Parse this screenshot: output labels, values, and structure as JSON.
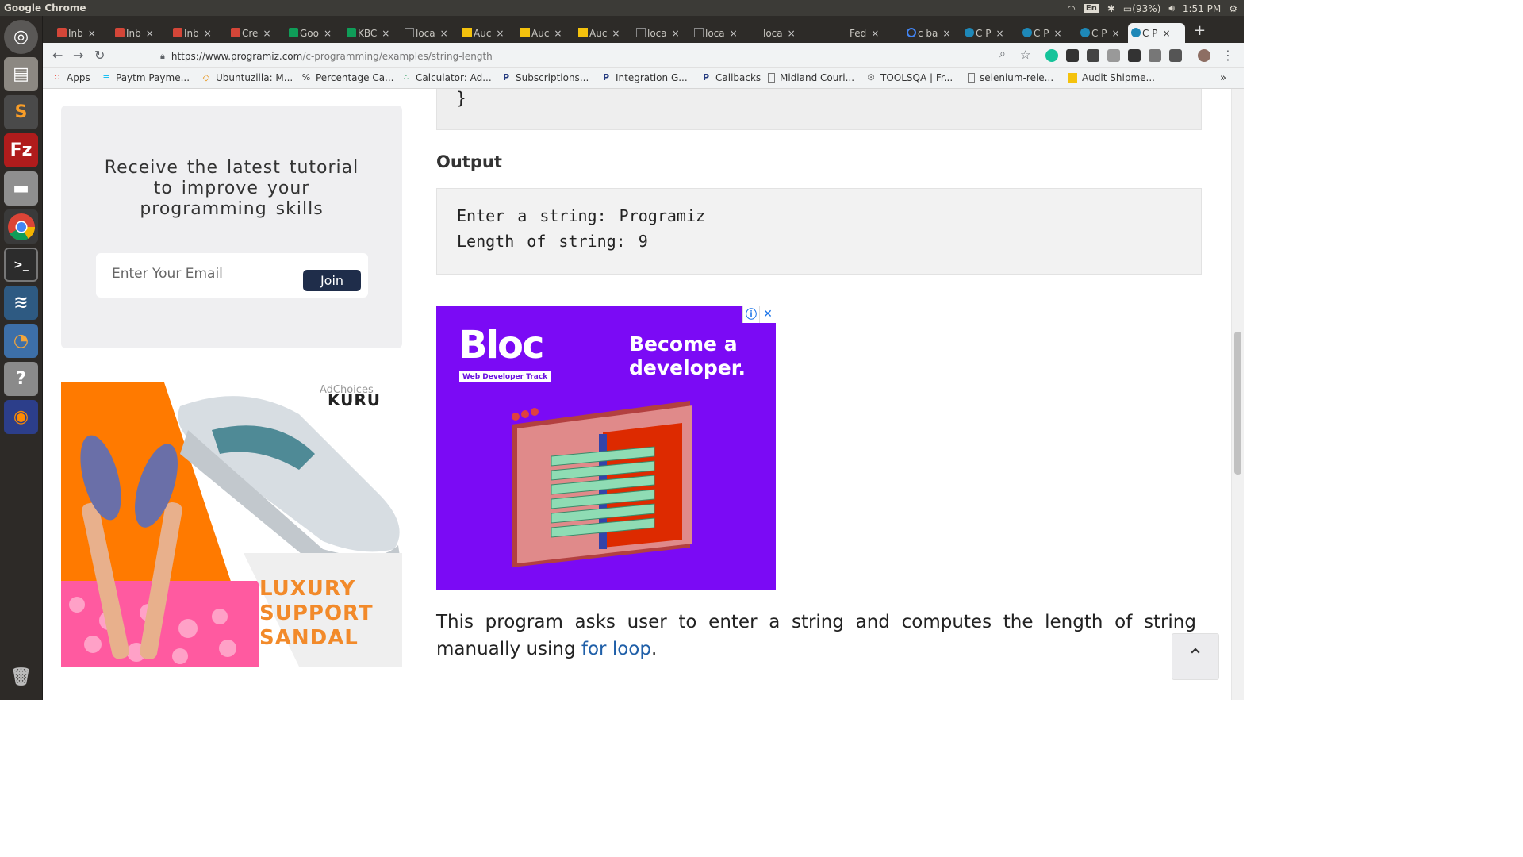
{
  "system_bar": {
    "app_name": "Google Chrome",
    "lang": "En",
    "battery": "(93%)",
    "time": "1:51 PM"
  },
  "launcher": {
    "items": [
      "ubuntu-home",
      "files",
      "sublime-text",
      "filezilla",
      "disk",
      "chrome",
      "terminal",
      "mysql-workbench",
      "blender",
      "help",
      "firefox",
      "trash"
    ]
  },
  "tabs": [
    {
      "label": "Inb",
      "icon": "gmail-icon"
    },
    {
      "label": "Inb",
      "icon": "gmail-icon"
    },
    {
      "label": "Inb",
      "icon": "gmail-icon"
    },
    {
      "label": "Cre",
      "icon": "gmail-icon"
    },
    {
      "label": "Goo",
      "icon": "sheets-icon"
    },
    {
      "label": "KBC",
      "icon": "sheets-icon"
    },
    {
      "label": "loca",
      "icon": "page-icon"
    },
    {
      "label": "Auc",
      "icon": "audit-icon"
    },
    {
      "label": "Auc",
      "icon": "audit-icon"
    },
    {
      "label": "Auc",
      "icon": "audit-icon"
    },
    {
      "label": "loca",
      "icon": "page-icon"
    },
    {
      "label": "loca",
      "icon": "page-icon"
    },
    {
      "label": "loca",
      "icon": "none"
    },
    {
      "label": "Fed",
      "icon": "none"
    },
    {
      "label": "c ba",
      "icon": "google-icon"
    },
    {
      "label": "C P",
      "icon": "programiz-icon"
    },
    {
      "label": "C P",
      "icon": "programiz-icon"
    },
    {
      "label": "C P",
      "icon": "programiz-icon"
    },
    {
      "label": "C P",
      "icon": "programiz-icon",
      "active": true
    }
  ],
  "address": {
    "url_host": "https://www.programiz.com",
    "url_path": "/c-programming/examples/string-length"
  },
  "bookmarks": [
    {
      "label": "Apps",
      "icon": "apps-grid-icon"
    },
    {
      "label": "Paytm Payme...",
      "icon": "paytm-icon"
    },
    {
      "label": "Ubuntuzilla: M...",
      "icon": "diamond-icon"
    },
    {
      "label": "Percentage Ca...",
      "icon": "percent-icon"
    },
    {
      "label": "Calculator: Ad...",
      "icon": "dots-icon"
    },
    {
      "label": "Subscriptions...",
      "icon": "paypal-icon"
    },
    {
      "label": "Integration G...",
      "icon": "paypal-icon"
    },
    {
      "label": "Callbacks",
      "icon": "paypal-icon"
    },
    {
      "label": "Midland Couri...",
      "icon": "page-icon"
    },
    {
      "label": "TOOLSQA | Fr...",
      "icon": "gear-icon"
    },
    {
      "label": "selenium-rele...",
      "icon": "page-icon"
    },
    {
      "label": "Audit Shipme...",
      "icon": "audit-icon"
    }
  ],
  "content": {
    "code_tail": "}",
    "output_heading": "Output",
    "output_lines": [
      "Enter a string: Programiz",
      "Length of string: 9"
    ],
    "paragraph_before_link": "This program asks user to enter a string and computes the length of string manually using ",
    "paragraph_link": "for loop",
    "paragraph_after_link": "."
  },
  "newsletter": {
    "title": "Receive the latest tutorial to improve your programming skills",
    "email_placeholder": "Enter Your Email",
    "join_label": "Join"
  },
  "ads": {
    "sandal": {
      "adchoices": "AdChoices",
      "brand": "KURU",
      "headline": [
        "LUXURY",
        "SUPPORT",
        "SANDAL"
      ]
    },
    "bloc": {
      "logo": "Bloc",
      "track": "Web Developer Track",
      "slogan": "Become a developer."
    }
  }
}
